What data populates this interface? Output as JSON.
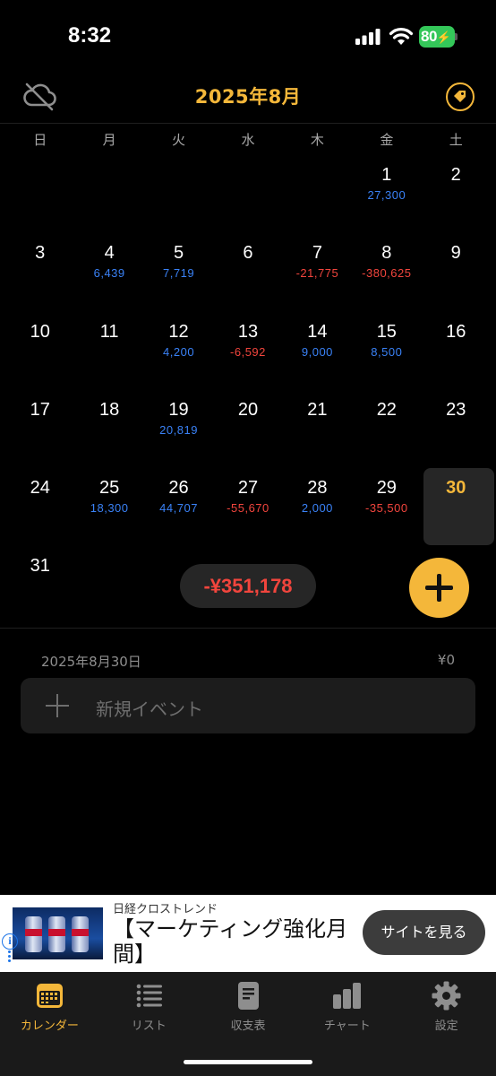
{
  "status": {
    "time": "8:32",
    "battery": "80"
  },
  "header": {
    "title": "2025年8月",
    "left_icon": "cloud-slash-icon",
    "right_icon": "tag-icon"
  },
  "weekdays": [
    "日",
    "月",
    "火",
    "水",
    "木",
    "金",
    "土"
  ],
  "calendar": {
    "weeks": [
      [
        {
          "d": "",
          "a": ""
        },
        {
          "d": "",
          "a": ""
        },
        {
          "d": "",
          "a": ""
        },
        {
          "d": "",
          "a": ""
        },
        {
          "d": "",
          "a": ""
        },
        {
          "d": "1",
          "a": "27,300"
        },
        {
          "d": "2",
          "a": ""
        }
      ],
      [
        {
          "d": "3",
          "a": ""
        },
        {
          "d": "4",
          "a": "6,439"
        },
        {
          "d": "5",
          "a": "7,719"
        },
        {
          "d": "6",
          "a": ""
        },
        {
          "d": "7",
          "a": "-21,775"
        },
        {
          "d": "8",
          "a": "-380,625"
        },
        {
          "d": "9",
          "a": ""
        }
      ],
      [
        {
          "d": "10",
          "a": ""
        },
        {
          "d": "11",
          "a": ""
        },
        {
          "d": "12",
          "a": "4,200"
        },
        {
          "d": "13",
          "a": "-6,592"
        },
        {
          "d": "14",
          "a": "9,000"
        },
        {
          "d": "15",
          "a": "8,500"
        },
        {
          "d": "16",
          "a": ""
        }
      ],
      [
        {
          "d": "17",
          "a": ""
        },
        {
          "d": "18",
          "a": ""
        },
        {
          "d": "19",
          "a": "20,819"
        },
        {
          "d": "20",
          "a": ""
        },
        {
          "d": "21",
          "a": ""
        },
        {
          "d": "22",
          "a": ""
        },
        {
          "d": "23",
          "a": ""
        }
      ],
      [
        {
          "d": "24",
          "a": ""
        },
        {
          "d": "25",
          "a": "18,300"
        },
        {
          "d": "26",
          "a": "44,707"
        },
        {
          "d": "27",
          "a": "-55,670"
        },
        {
          "d": "28",
          "a": "2,000"
        },
        {
          "d": "29",
          "a": "-35,500"
        },
        {
          "d": "30",
          "a": "",
          "today": true
        }
      ],
      [
        {
          "d": "31",
          "a": ""
        },
        {
          "d": "",
          "a": ""
        },
        {
          "d": "",
          "a": ""
        },
        {
          "d": "",
          "a": ""
        },
        {
          "d": "",
          "a": ""
        },
        {
          "d": "",
          "a": ""
        },
        {
          "d": "",
          "a": ""
        }
      ]
    ]
  },
  "month_total": "-¥351,178",
  "selected": {
    "date": "2025年8月30日",
    "total": "¥0",
    "new_event_label": "新規イベント"
  },
  "ad": {
    "advertiser": "日経クロストレンド",
    "headline": "【マーケティング強化月間】",
    "cta": "サイトを見る"
  },
  "tabs": [
    {
      "label": "カレンダー",
      "icon": "calendar-icon",
      "active": true
    },
    {
      "label": "リスト",
      "icon": "list-icon",
      "active": false
    },
    {
      "label": "収支表",
      "icon": "document-icon",
      "active": false
    },
    {
      "label": "チャート",
      "icon": "bar-chart-icon",
      "active": false
    },
    {
      "label": "設定",
      "icon": "gear-icon",
      "active": false
    }
  ],
  "colors": {
    "accent": "#f4b73a",
    "income": "#3a82f7",
    "expense": "#f2453d",
    "background": "#000000"
  }
}
